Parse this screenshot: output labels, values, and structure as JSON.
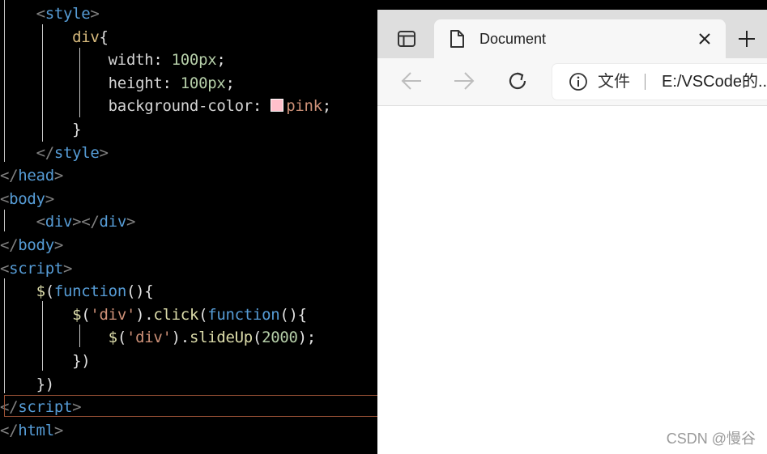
{
  "editor": {
    "lines": [
      [
        {
          "t": "    "
        },
        {
          "t": "<",
          "c": "br"
        },
        {
          "t": "style",
          "c": "tag"
        },
        {
          "t": ">",
          "c": "br"
        }
      ],
      [
        {
          "t": "        "
        },
        {
          "t": "div",
          "c": "sel"
        },
        {
          "t": "{",
          "c": "pl"
        }
      ],
      [
        {
          "t": "            "
        },
        {
          "t": "width",
          "c": "prop"
        },
        {
          "t": ": ",
          "c": "pl"
        },
        {
          "t": "100px",
          "c": "num"
        },
        {
          "t": ";",
          "c": "pl"
        }
      ],
      [
        {
          "t": "            "
        },
        {
          "t": "height",
          "c": "prop"
        },
        {
          "t": ": ",
          "c": "pl"
        },
        {
          "t": "100px",
          "c": "num"
        },
        {
          "t": ";",
          "c": "pl"
        }
      ],
      [
        {
          "t": "            "
        },
        {
          "t": "background-color",
          "c": "prop"
        },
        {
          "t": ": ",
          "c": "pl"
        },
        {
          "swatch": "#ffc0cb"
        },
        {
          "t": "pink",
          "c": "val"
        },
        {
          "t": ";",
          "c": "pl"
        }
      ],
      [
        {
          "t": "        "
        },
        {
          "t": "}",
          "c": "pl"
        }
      ],
      [
        {
          "t": "    "
        },
        {
          "t": "</",
          "c": "br"
        },
        {
          "t": "style",
          "c": "tag"
        },
        {
          "t": ">",
          "c": "br"
        }
      ],
      [
        {
          "t": "</",
          "c": "br"
        },
        {
          "t": "head",
          "c": "tag"
        },
        {
          "t": ">",
          "c": "br"
        }
      ],
      [
        {
          "t": "<",
          "c": "br"
        },
        {
          "t": "body",
          "c": "tag"
        },
        {
          "t": ">",
          "c": "br"
        }
      ],
      [
        {
          "t": "    "
        },
        {
          "t": "<",
          "c": "br"
        },
        {
          "t": "div",
          "c": "tag"
        },
        {
          "t": "></",
          "c": "br"
        },
        {
          "t": "div",
          "c": "tag"
        },
        {
          "t": ">",
          "c": "br"
        }
      ],
      [
        {
          "t": "</",
          "c": "br"
        },
        {
          "t": "body",
          "c": "tag"
        },
        {
          "t": ">",
          "c": "br"
        }
      ],
      [
        {
          "t": "<",
          "c": "br"
        },
        {
          "t": "script",
          "c": "tag"
        },
        {
          "t": ">",
          "c": "br"
        }
      ],
      [
        {
          "t": "    "
        },
        {
          "t": "$",
          "c": "fn"
        },
        {
          "t": "(",
          "c": "pl"
        },
        {
          "t": "function",
          "c": "kw"
        },
        {
          "t": "(){",
          "c": "pl"
        }
      ],
      [
        {
          "t": "        "
        },
        {
          "t": "$",
          "c": "fn"
        },
        {
          "t": "(",
          "c": "pl"
        },
        {
          "t": "'div'",
          "c": "str"
        },
        {
          "t": ").",
          "c": "pl"
        },
        {
          "t": "click",
          "c": "fn"
        },
        {
          "t": "(",
          "c": "pl"
        },
        {
          "t": "function",
          "c": "kw"
        },
        {
          "t": "(){",
          "c": "pl"
        }
      ],
      [
        {
          "t": "            "
        },
        {
          "t": "$",
          "c": "fn"
        },
        {
          "t": "(",
          "c": "pl"
        },
        {
          "t": "'div'",
          "c": "str"
        },
        {
          "t": ").",
          "c": "pl"
        },
        {
          "t": "slideUp",
          "c": "fn"
        },
        {
          "t": "(",
          "c": "pl"
        },
        {
          "t": "2000",
          "c": "num"
        },
        {
          "t": ");",
          "c": "pl"
        }
      ],
      [
        {
          "t": "        "
        },
        {
          "t": "})",
          "c": "pl"
        }
      ],
      [
        {
          "t": "    "
        },
        {
          "t": "})",
          "c": "pl"
        }
      ],
      [
        {
          "t": "</",
          "c": "br"
        },
        {
          "t": "script",
          "c": "tag"
        },
        {
          "t": ">",
          "c": "br"
        }
      ],
      [
        {
          "t": "</",
          "c": "br"
        },
        {
          "t": "html",
          "c": "tag"
        },
        {
          "t": ">",
          "c": "br"
        }
      ]
    ],
    "current_line": 18
  },
  "browser": {
    "tab": {
      "title": "Document",
      "icon": "document-icon",
      "close_icon": "close-icon"
    },
    "tab_actions_icon": "tab-actions-icon",
    "new_tab_icon": "plus-icon",
    "nav": {
      "back_icon": "back-arrow-icon",
      "forward_icon": "forward-arrow-icon",
      "refresh_icon": "refresh-icon"
    },
    "address": {
      "info_icon": "info-icon",
      "site_label": "文件",
      "url": "E:/VSCode的..."
    }
  },
  "watermark": "CSDN @慢谷"
}
